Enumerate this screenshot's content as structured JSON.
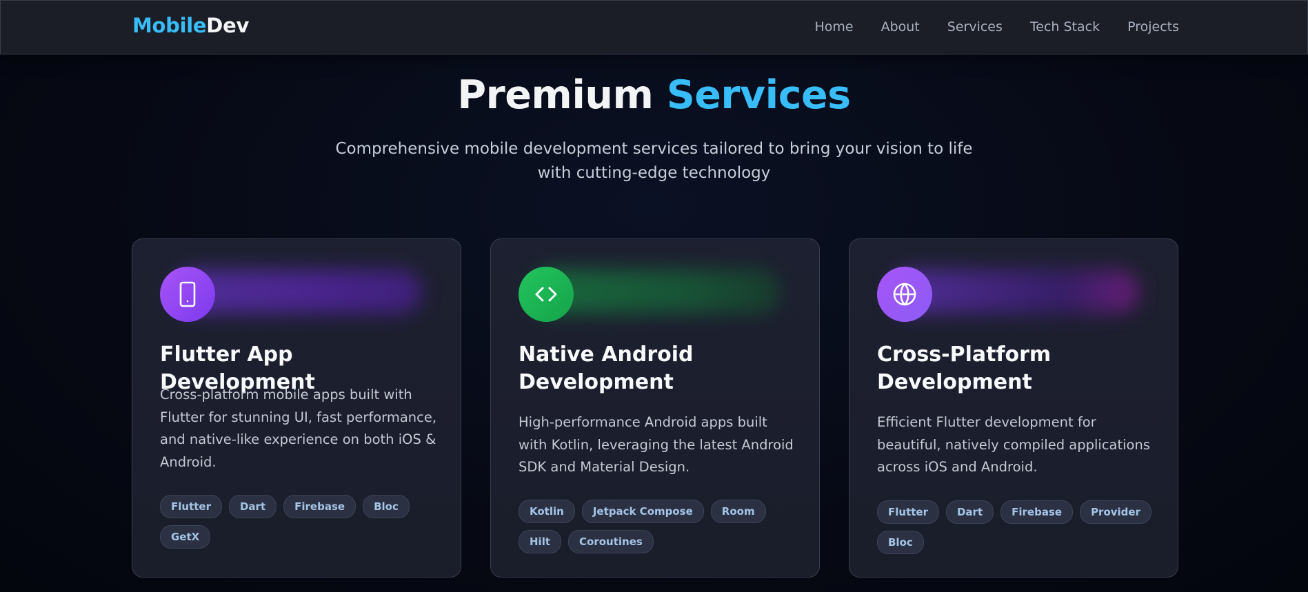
{
  "nav": {
    "logo_part1": "Mobile",
    "logo_part2": "Dev",
    "links": [
      "Home",
      "About",
      "Services",
      "Tech Stack",
      "Projects"
    ]
  },
  "hero": {
    "title_part1": "Premium",
    "title_part2": "Services",
    "subtitle": "Comprehensive mobile development services tailored to bring your vision to life with cutting-edge technology"
  },
  "cards": [
    {
      "icon": "smartphone-icon",
      "accent": "#a855f7",
      "title": "Flutter App Development",
      "description": "Cross-platform mobile apps built with Flutter for stunning UI, fast performance, and native-like experience on both iOS & Android.",
      "tags": [
        "Flutter",
        "Dart",
        "Firebase",
        "Bloc",
        "GetX"
      ]
    },
    {
      "icon": "code-icon",
      "accent": "#22c55e",
      "title": "Native Android Development",
      "description": "High-performance Android apps built with Kotlin, leveraging the latest Android SDK and Material Design.",
      "tags": [
        "Kotlin",
        "Jetpack Compose",
        "Room",
        "Hilt",
        "Coroutines"
      ]
    },
    {
      "icon": "globe-icon",
      "accent": "#8b5cf6",
      "title": "Cross-Platform Development",
      "description": "Efficient Flutter development for beautiful, natively compiled applications across iOS and Android.",
      "tags": [
        "Flutter",
        "Dart",
        "Firebase",
        "Provider",
        "Bloc"
      ]
    }
  ],
  "colors": {
    "background": "#060914",
    "nav_bg": "#1b1e27",
    "accent_blue": "#38bdf8",
    "card_bg": "#1d2030",
    "tag_text": "#a5c4e6"
  }
}
